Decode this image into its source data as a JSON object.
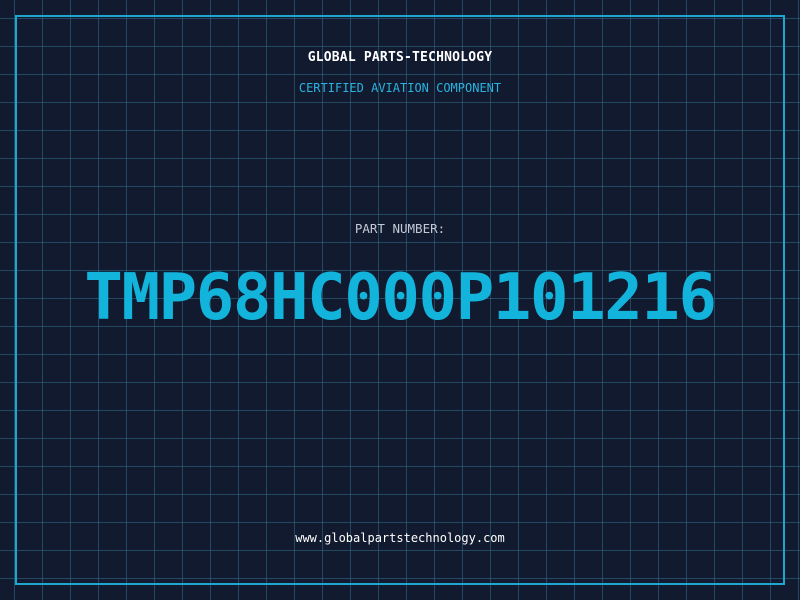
{
  "label": {
    "company": "GLOBAL PARTS-TECHNOLOGY",
    "certification": "CERTIFIED AVIATION COMPONENT",
    "part_number_label": "PART NUMBER:",
    "part_number": "TMP68HC000P101216",
    "website": "www.globalpartstechnology.com"
  },
  "colors": {
    "background": "#111a2e",
    "grid": "#306e8c",
    "frame": "#1fa6cf",
    "accent": "#12b4dc",
    "text_light": "#ffffff",
    "text_muted": "#c3cad6"
  }
}
